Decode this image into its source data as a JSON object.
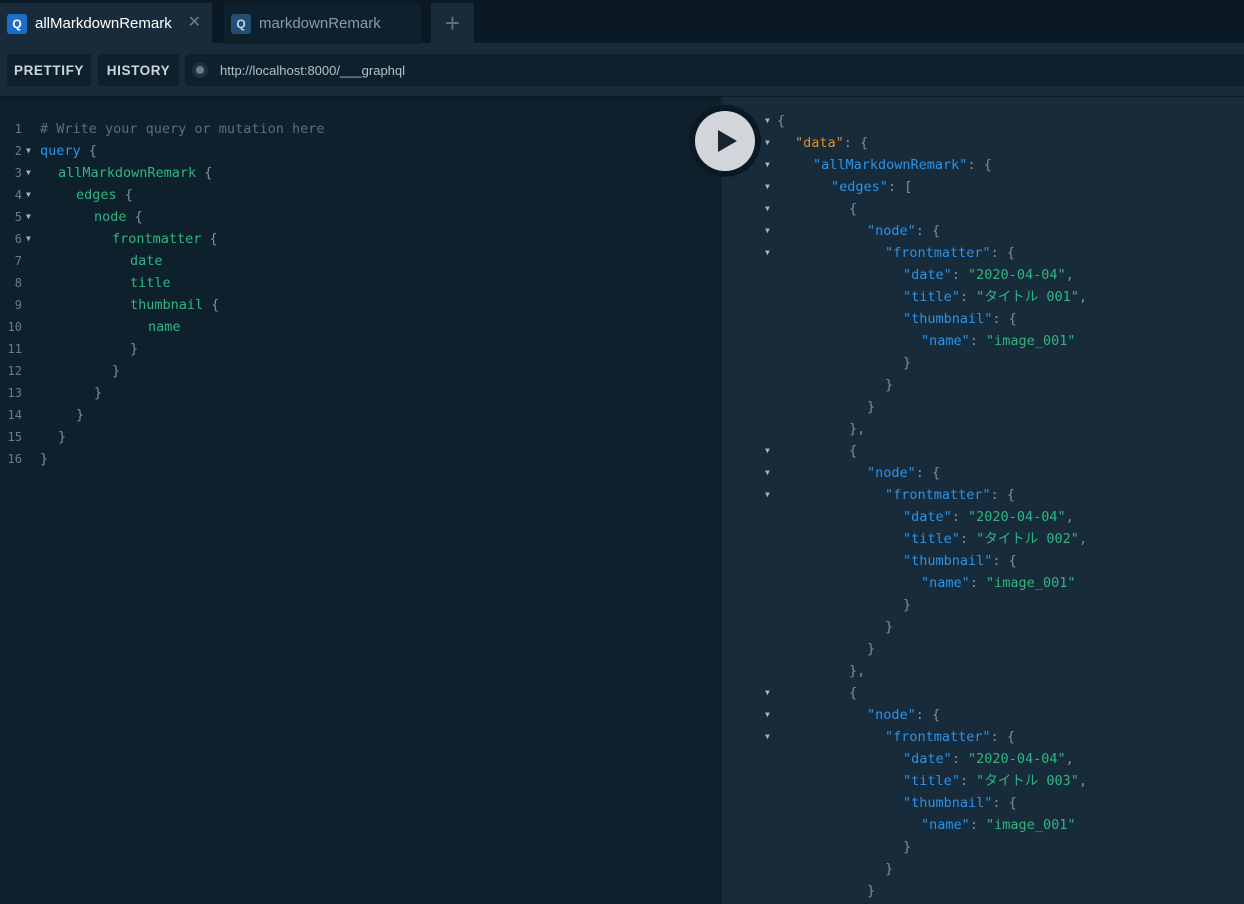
{
  "tabs": [
    {
      "badge": "Q",
      "label": "allMarkdownRemark",
      "close": "✕",
      "active": true
    },
    {
      "badge": "Q",
      "label": "markdownRemark",
      "active": false
    }
  ],
  "add_tab_label": "+",
  "toolbar": {
    "prettify_label": "PRETTIFY",
    "history_label": "HISTORY",
    "url": "http://localhost:8000/___graphql"
  },
  "editor": {
    "lines": [
      {
        "n": "1",
        "fold": false,
        "indent": 0,
        "tokens": [
          [
            "comment",
            "# Write your query or mutation here"
          ]
        ]
      },
      {
        "n": "2",
        "fold": true,
        "indent": 0,
        "tokens": [
          [
            "kw",
            "query"
          ],
          [
            "punct",
            " {"
          ]
        ]
      },
      {
        "n": "3",
        "fold": true,
        "indent": 1,
        "tokens": [
          [
            "field",
            "allMarkdownRemark"
          ],
          [
            "punct",
            " {"
          ]
        ]
      },
      {
        "n": "4",
        "fold": true,
        "indent": 2,
        "tokens": [
          [
            "field",
            "edges"
          ],
          [
            "punct",
            " {"
          ]
        ]
      },
      {
        "n": "5",
        "fold": true,
        "indent": 3,
        "tokens": [
          [
            "field",
            "node"
          ],
          [
            "punct",
            " {"
          ]
        ]
      },
      {
        "n": "6",
        "fold": true,
        "indent": 4,
        "tokens": [
          [
            "field",
            "frontmatter"
          ],
          [
            "punct",
            " {"
          ]
        ]
      },
      {
        "n": "7",
        "fold": false,
        "indent": 5,
        "tokens": [
          [
            "field",
            "date"
          ]
        ]
      },
      {
        "n": "8",
        "fold": false,
        "indent": 5,
        "tokens": [
          [
            "field",
            "title"
          ]
        ]
      },
      {
        "n": "9",
        "fold": false,
        "indent": 5,
        "tokens": [
          [
            "field",
            "thumbnail"
          ],
          [
            "punct",
            " {"
          ]
        ]
      },
      {
        "n": "10",
        "fold": false,
        "indent": 6,
        "tokens": [
          [
            "field",
            "name"
          ]
        ]
      },
      {
        "n": "11",
        "fold": false,
        "indent": 5,
        "tokens": [
          [
            "punct",
            "}"
          ]
        ]
      },
      {
        "n": "12",
        "fold": false,
        "indent": 4,
        "tokens": [
          [
            "punct",
            "}"
          ]
        ]
      },
      {
        "n": "13",
        "fold": false,
        "indent": 3,
        "tokens": [
          [
            "punct",
            "}"
          ]
        ]
      },
      {
        "n": "14",
        "fold": false,
        "indent": 2,
        "tokens": [
          [
            "punct",
            "}"
          ]
        ]
      },
      {
        "n": "15",
        "fold": false,
        "indent": 1,
        "tokens": [
          [
            "punct",
            "}"
          ]
        ]
      },
      {
        "n": "16",
        "fold": false,
        "indent": 0,
        "tokens": [
          [
            "punct",
            "}"
          ]
        ]
      }
    ]
  },
  "run_button": {
    "icon": "play-icon"
  },
  "result": {
    "lines": [
      {
        "fold": true,
        "indent": 0,
        "tokens": [
          [
            "punct",
            "{"
          ]
        ]
      },
      {
        "fold": true,
        "indent": 1,
        "tokens": [
          [
            "datakey",
            "\"data\""
          ],
          [
            "punct",
            ": {"
          ]
        ]
      },
      {
        "fold": true,
        "indent": 2,
        "tokens": [
          [
            "key",
            "\"allMarkdownRemark\""
          ],
          [
            "punct",
            ": {"
          ]
        ]
      },
      {
        "fold": true,
        "indent": 3,
        "tokens": [
          [
            "key",
            "\"edges\""
          ],
          [
            "punct",
            ": ["
          ]
        ]
      },
      {
        "fold": true,
        "indent": 4,
        "tokens": [
          [
            "punct",
            "{"
          ]
        ]
      },
      {
        "fold": true,
        "indent": 5,
        "tokens": [
          [
            "key",
            "\"node\""
          ],
          [
            "punct",
            ": {"
          ]
        ]
      },
      {
        "fold": true,
        "indent": 6,
        "tokens": [
          [
            "key",
            "\"frontmatter\""
          ],
          [
            "punct",
            ": {"
          ]
        ]
      },
      {
        "fold": false,
        "indent": 7,
        "tokens": [
          [
            "key",
            "\"date\""
          ],
          [
            "punct",
            ": "
          ],
          [
            "str",
            "\"2020-04-04\""
          ],
          [
            "punct",
            ","
          ]
        ]
      },
      {
        "fold": false,
        "indent": 7,
        "tokens": [
          [
            "key",
            "\"title\""
          ],
          [
            "punct",
            ": "
          ],
          [
            "str",
            "\"タイトル 001\""
          ],
          [
            "punct",
            ","
          ]
        ]
      },
      {
        "fold": false,
        "indent": 7,
        "tokens": [
          [
            "key",
            "\"thumbnail\""
          ],
          [
            "punct",
            ": {"
          ]
        ]
      },
      {
        "fold": false,
        "indent": 8,
        "tokens": [
          [
            "key",
            "\"name\""
          ],
          [
            "punct",
            ": "
          ],
          [
            "str",
            "\"image_001\""
          ]
        ]
      },
      {
        "fold": false,
        "indent": 7,
        "tokens": [
          [
            "punct",
            "}"
          ]
        ]
      },
      {
        "fold": false,
        "indent": 6,
        "tokens": [
          [
            "punct",
            "}"
          ]
        ]
      },
      {
        "fold": false,
        "indent": 5,
        "tokens": [
          [
            "punct",
            "}"
          ]
        ]
      },
      {
        "fold": false,
        "indent": 4,
        "tokens": [
          [
            "punct",
            "},"
          ]
        ]
      },
      {
        "fold": true,
        "indent": 4,
        "tokens": [
          [
            "punct",
            "{"
          ]
        ]
      },
      {
        "fold": true,
        "indent": 5,
        "tokens": [
          [
            "key",
            "\"node\""
          ],
          [
            "punct",
            ": {"
          ]
        ]
      },
      {
        "fold": true,
        "indent": 6,
        "tokens": [
          [
            "key",
            "\"frontmatter\""
          ],
          [
            "punct",
            ": {"
          ]
        ]
      },
      {
        "fold": false,
        "indent": 7,
        "tokens": [
          [
            "key",
            "\"date\""
          ],
          [
            "punct",
            ": "
          ],
          [
            "str",
            "\"2020-04-04\""
          ],
          [
            "punct",
            ","
          ]
        ]
      },
      {
        "fold": false,
        "indent": 7,
        "tokens": [
          [
            "key",
            "\"title\""
          ],
          [
            "punct",
            ": "
          ],
          [
            "str",
            "\"タイトル 002\""
          ],
          [
            "punct",
            ","
          ]
        ]
      },
      {
        "fold": false,
        "indent": 7,
        "tokens": [
          [
            "key",
            "\"thumbnail\""
          ],
          [
            "punct",
            ": {"
          ]
        ]
      },
      {
        "fold": false,
        "indent": 8,
        "tokens": [
          [
            "key",
            "\"name\""
          ],
          [
            "punct",
            ": "
          ],
          [
            "str",
            "\"image_001\""
          ]
        ]
      },
      {
        "fold": false,
        "indent": 7,
        "tokens": [
          [
            "punct",
            "}"
          ]
        ]
      },
      {
        "fold": false,
        "indent": 6,
        "tokens": [
          [
            "punct",
            "}"
          ]
        ]
      },
      {
        "fold": false,
        "indent": 5,
        "tokens": [
          [
            "punct",
            "}"
          ]
        ]
      },
      {
        "fold": false,
        "indent": 4,
        "tokens": [
          [
            "punct",
            "},"
          ]
        ]
      },
      {
        "fold": true,
        "indent": 4,
        "tokens": [
          [
            "punct",
            "{"
          ]
        ]
      },
      {
        "fold": true,
        "indent": 5,
        "tokens": [
          [
            "key",
            "\"node\""
          ],
          [
            "punct",
            ": {"
          ]
        ]
      },
      {
        "fold": true,
        "indent": 6,
        "tokens": [
          [
            "key",
            "\"frontmatter\""
          ],
          [
            "punct",
            ": {"
          ]
        ]
      },
      {
        "fold": false,
        "indent": 7,
        "tokens": [
          [
            "key",
            "\"date\""
          ],
          [
            "punct",
            ": "
          ],
          [
            "str",
            "\"2020-04-04\""
          ],
          [
            "punct",
            ","
          ]
        ]
      },
      {
        "fold": false,
        "indent": 7,
        "tokens": [
          [
            "key",
            "\"title\""
          ],
          [
            "punct",
            ": "
          ],
          [
            "str",
            "\"タイトル 003\""
          ],
          [
            "punct",
            ","
          ]
        ]
      },
      {
        "fold": false,
        "indent": 7,
        "tokens": [
          [
            "key",
            "\"thumbnail\""
          ],
          [
            "punct",
            ": {"
          ]
        ]
      },
      {
        "fold": false,
        "indent": 8,
        "tokens": [
          [
            "key",
            "\"name\""
          ],
          [
            "punct",
            ": "
          ],
          [
            "str",
            "\"image_001\""
          ]
        ]
      },
      {
        "fold": false,
        "indent": 7,
        "tokens": [
          [
            "punct",
            "}"
          ]
        ]
      },
      {
        "fold": false,
        "indent": 6,
        "tokens": [
          [
            "punct",
            "}"
          ]
        ]
      },
      {
        "fold": false,
        "indent": 5,
        "tokens": [
          [
            "punct",
            "}"
          ]
        ]
      }
    ]
  }
}
